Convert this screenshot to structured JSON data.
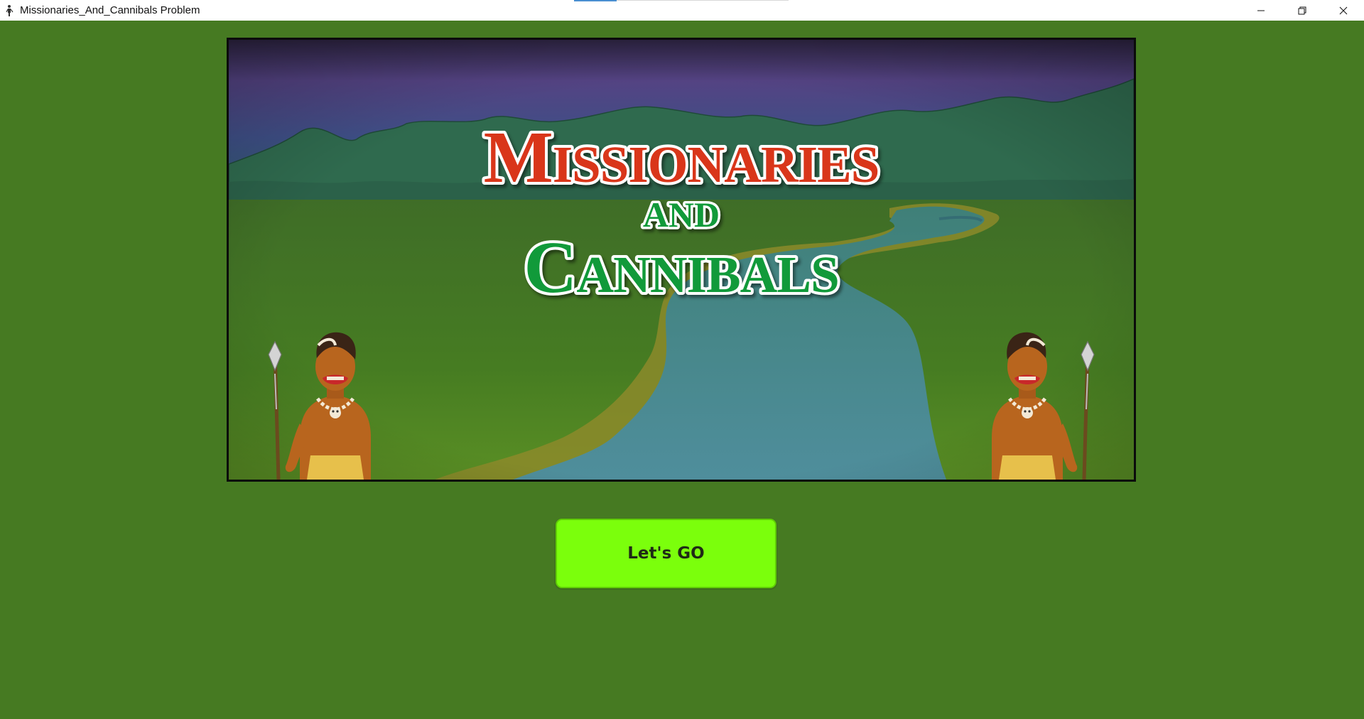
{
  "window": {
    "title": "Missionaries_And_Cannibals Problem",
    "icon": "person-walking-icon",
    "controls": {
      "minimize": "minimize-icon",
      "maximize": "restore-icon",
      "close": "close-icon"
    }
  },
  "banner": {
    "title_line1": "Missionaries",
    "title_line2": "and",
    "title_line3": "Cannibals",
    "scene": "river-valley-at-dusk",
    "characters": [
      "cannibal-warrior-left",
      "cannibal-warrior-right"
    ]
  },
  "actions": {
    "go_label": "Let's GO"
  },
  "colors": {
    "background": "#467a22",
    "button": "#7bff0c",
    "title_red": "#d9361a",
    "title_green": "#119a3a",
    "sky_top": "#2e2440",
    "sky_mid": "#5a4a8a",
    "river": "#4a8a96"
  }
}
